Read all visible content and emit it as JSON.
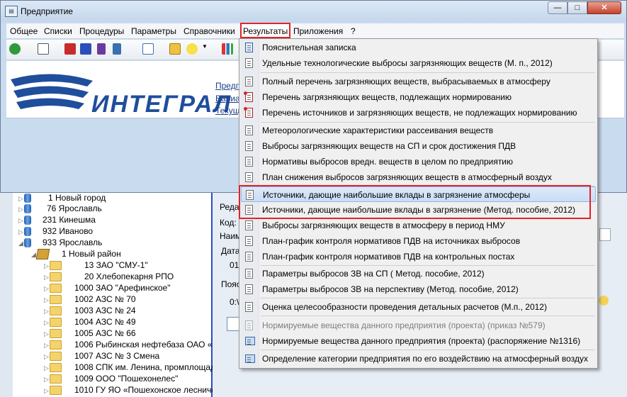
{
  "window": {
    "title": "Предприятие",
    "min": "—",
    "max": "□",
    "close": "✕"
  },
  "menubar": [
    "Общее",
    "Списки",
    "Процедуры",
    "Параметры",
    "Справочники",
    "Результаты",
    "Приложения",
    "?"
  ],
  "banner": {
    "logo": "ИНТЕГРАЛ",
    "links": [
      "Предпр",
      "Вариан",
      "Текущ"
    ]
  },
  "dropdown": {
    "items": [
      {
        "label": "Пояснительная записка",
        "icon": "word-icon"
      },
      {
        "label": "Удельные технологические выбросы загрязняющих веществ (М. п., 2012)",
        "icon": "document-icon"
      },
      {
        "label": "Полный перечень загрязняющих веществ, выбрасываемых в атмосферу",
        "icon": "document-icon"
      },
      {
        "label": "Перечень загрязняющих веществ, подлежащих нормированию",
        "icon": "document-red-icon"
      },
      {
        "label": "Перечень источников и загрязняющих веществ, не подлежащих нормированию",
        "icon": "document-red-icon"
      },
      {
        "label": "Метеорологические характеристики рассеивания веществ",
        "icon": "document-icon"
      },
      {
        "label": "Выбросы загрязняющих веществ на СП и срок достижения ПДВ",
        "icon": "document-icon"
      },
      {
        "label": "Нормативы выбросов вредн. веществ в целом по предприятию",
        "icon": "document-icon"
      },
      {
        "label": "План снижения выбросов загрязняющих веществ в атмосферный воздух",
        "icon": "document-icon"
      },
      {
        "label": "Источники, дающие наибольшие вклады в загрязнение атмосферы",
        "icon": "document-icon"
      },
      {
        "label": "Источники, дающие наибольшие вклады в загрязнение (Метод. пособие, 2012)",
        "icon": "document-icon"
      },
      {
        "label": "Выбросы загрязняющих веществ в атмосферу в период НМУ",
        "icon": "document-icon"
      },
      {
        "label": "План-график контроля нормативов ПДВ на источниках выбросов",
        "icon": "document-icon"
      },
      {
        "label": "План-график контроля нормативов ПДВ на контрольных постах",
        "icon": "document-icon"
      },
      {
        "label": "Параметры выбросов ЗВ на СП  ( Метод. пособие, 2012)",
        "icon": "document-icon"
      },
      {
        "label": "Параметры выбросов ЗВ на перспективу  (Метод. пособие, 2012)",
        "icon": "document-icon"
      },
      {
        "label": "Оценка целесообразности проведения детальных расчетов  (М.п., 2012)",
        "icon": "document-icon"
      },
      {
        "label": "Нормируемые вещества данного предприятия (проекта) (приказ №579)",
        "icon": "document-icon"
      },
      {
        "label": "Нормируемые вещества данного предприятия (проекта)  (распоряжение №1316)",
        "icon": "sheet-icon"
      },
      {
        "label": "Определение категории предприятия по его воздействию на атмосферный воздух",
        "icon": "sheet-icon"
      }
    ]
  },
  "tree": [
    {
      "label": "1 Новый город"
    },
    {
      "label": "76 Ярославль"
    },
    {
      "label": "231 Кинешма"
    },
    {
      "label": "932 Иваново"
    },
    {
      "label": "933 Ярославль"
    },
    {
      "label": "1 Новый район"
    },
    {
      "label": "13 ЗАО \"СМУ-1\""
    },
    {
      "label": "20 Хлебопекарня РПО"
    },
    {
      "label": "1000 ЗАО \"Арефинское\""
    },
    {
      "label": "1002 АЗС № 70"
    },
    {
      "label": "1003 АЗС № 24"
    },
    {
      "label": "1004 АЗС № 49"
    },
    {
      "label": "1005 АЗС № 66"
    },
    {
      "label": "1006 Рыбинская нефтебаза ОАО «Г"
    },
    {
      "label": "1007 АЗС № 3 Смена"
    },
    {
      "label": "1008 СПК им. Ленина, промплощад"
    },
    {
      "label": "1009 ООО \"Пошехонелес\""
    },
    {
      "label": "1010 ГУ ЯО «Пошехонское лесниче"
    }
  ],
  "rightpane": {
    "labels": [
      "Реда",
      "Код:",
      "Наим",
      "Дата",
      "01",
      "Пояс",
      "0:\\"
    ]
  }
}
